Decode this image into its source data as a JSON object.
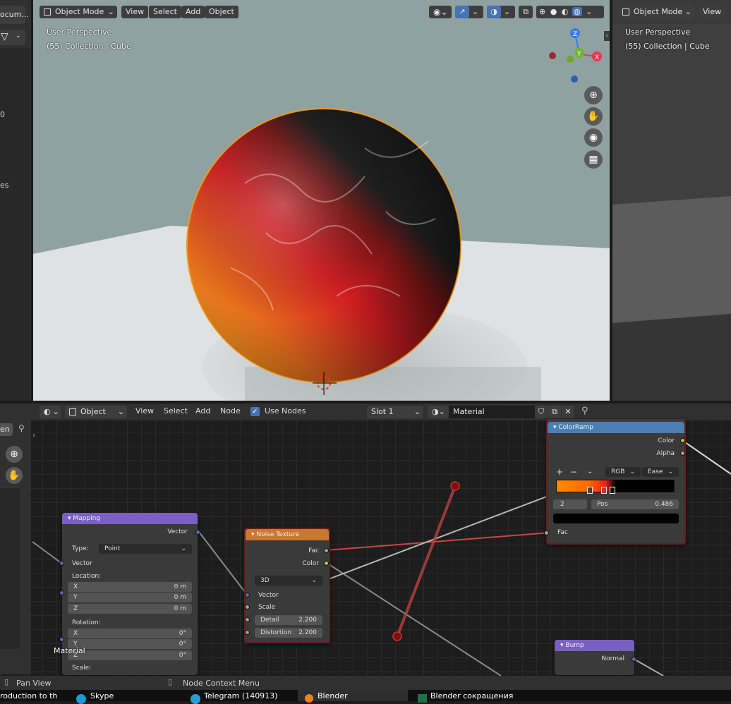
{
  "left_panel": {
    "doc_button": "ocum...",
    "fragments": [
      "0",
      "es"
    ],
    "node_tab": "en"
  },
  "viewport": {
    "mode": "Object Mode",
    "menus": [
      "View",
      "Select",
      "Add",
      "Object"
    ],
    "perspective": "User Perspective",
    "collection": "(55) Collection | Cube",
    "gizmo": {
      "x": "X",
      "y": "Y",
      "z": "Z"
    }
  },
  "right_viewport": {
    "mode": "Object Mode",
    "view": "View",
    "perspective": "User Perspective",
    "collection": "(55) Collection | Cube"
  },
  "node_editor": {
    "type": "Object",
    "menus": [
      "View",
      "Select",
      "Add",
      "Node"
    ],
    "use_nodes_label": "Use Nodes",
    "use_nodes_checked": true,
    "slot": "Slot 1",
    "material": "Material",
    "overlay_label": "Material"
  },
  "nodes": {
    "mapping": {
      "title": "Mapping",
      "out_vector": "Vector",
      "type_label": "Type:",
      "type_value": "Point",
      "in_vector": "Vector",
      "location_label": "Location:",
      "location": [
        {
          "axis": "X",
          "value": "0 m"
        },
        {
          "axis": "Y",
          "value": "0 m"
        },
        {
          "axis": "Z",
          "value": "0 m"
        }
      ],
      "rotation_label": "Rotation:",
      "rotation": [
        {
          "axis": "X",
          "value": "0°"
        },
        {
          "axis": "Y",
          "value": "0°"
        },
        {
          "axis": "Z",
          "value": "0°"
        }
      ],
      "scale_label": "Scale:"
    },
    "noise": {
      "title": "Noise Texture",
      "fac": "Fac",
      "color": "Color",
      "dim": "3D",
      "vector": "Vector",
      "scale": "Scale",
      "detail_label": "Detail",
      "detail_value": "2.200",
      "distortion_label": "Distortion",
      "distortion_value": "2.200"
    },
    "colorramp": {
      "title": "ColorRamp",
      "color": "Color",
      "alpha": "Alpha",
      "plus": "+",
      "minus": "−",
      "mode": "RGB",
      "interp": "Ease",
      "index": "2",
      "pos_label": "Pos",
      "pos_value": "0.486",
      "fac": "Fac"
    },
    "bump": {
      "title": "Bump",
      "normal": "Normal"
    }
  },
  "statusbar": {
    "pan": "Pan View",
    "context": "Node Context Menu"
  },
  "taskbar": {
    "items": [
      "roduction to th",
      "Skype",
      "Telegram (140913)",
      "Blender",
      "Blender сокращения"
    ]
  },
  "colors": {
    "mapping_header": "#7b5fc4",
    "noise_header": "#c9782f",
    "colorramp_header": "#4a7fb4",
    "bump_header": "#7a5fc2",
    "selection_outline": "#f39a1b",
    "vector_socket": "#6363c7",
    "color_socket": "#c7c729",
    "float_socket": "#a1a1a1"
  }
}
